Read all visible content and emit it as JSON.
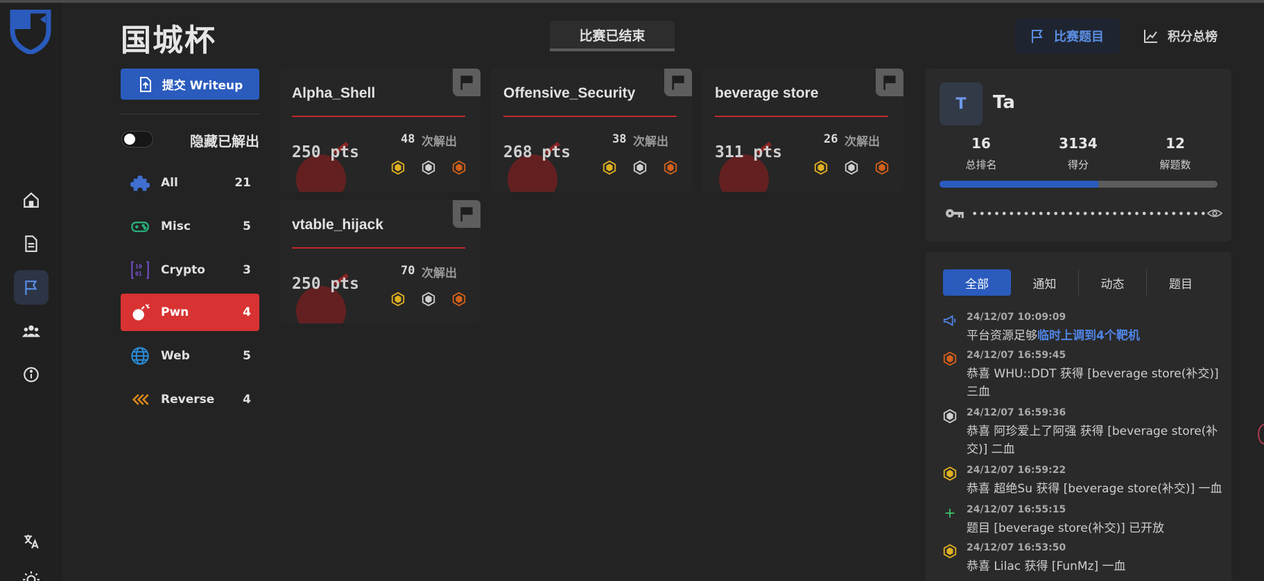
{
  "brand": "国城杯",
  "status": "比赛已结束",
  "nav": {
    "challenges": "比赛题目",
    "scoreboard": "积分总榜"
  },
  "submit_writeup": "提交 Writeup",
  "hide_solved": "隐藏已解出",
  "categories": [
    {
      "label": "All",
      "count": "21",
      "icon": "puzzle-icon"
    },
    {
      "label": "Misc",
      "count": "5",
      "icon": "gamepad-icon"
    },
    {
      "label": "Crypto",
      "count": "3",
      "icon": "binary-icon"
    },
    {
      "label": "Pwn",
      "count": "4",
      "icon": "bomb-icon"
    },
    {
      "label": "Web",
      "count": "5",
      "icon": "globe-icon"
    },
    {
      "label": "Reverse",
      "count": "4",
      "icon": "rewind-icon"
    }
  ],
  "challenges": [
    {
      "title": "Alpha_Shell",
      "points": "250 pts",
      "solves": "48",
      "solves_label": "次解出"
    },
    {
      "title": "Offensive_Security",
      "points": "268 pts",
      "solves": "38",
      "solves_label": "次解出"
    },
    {
      "title": "beverage store",
      "points": "311 pts",
      "solves": "26",
      "solves_label": "次解出"
    },
    {
      "title": "vtable_hijack",
      "points": "250 pts",
      "solves": "70",
      "solves_label": "次解出"
    }
  ],
  "user": {
    "avatar_letter": "T",
    "name": "Ta",
    "rank": "16",
    "rank_label": "总排名",
    "score": "3134",
    "score_label": "得分",
    "solved": "12",
    "solved_label": "解题数",
    "progress": 0.57,
    "token_masked": "••••••••••••••••••••••••••••••••"
  },
  "feed": {
    "tabs": [
      "全部",
      "通知",
      "动态",
      "题目"
    ],
    "entries": [
      {
        "icon": "megaphone-icon",
        "time": "24/12/07 10:09:09",
        "text": "平台资源足够",
        "highlight": "临时上调到4个靶机"
      },
      {
        "icon": "third-blood-icon",
        "time": "24/12/07 16:59:45",
        "text": "恭喜 WHU::DDT 获得 [beverage store(补交)] 三血"
      },
      {
        "icon": "second-blood-icon",
        "time": "24/12/07 16:59:36",
        "text": "恭喜 阿珍爱上了阿强 获得 [beverage store(补交)] 二血"
      },
      {
        "icon": "first-blood-icon",
        "time": "24/12/07 16:59:22",
        "text": "恭喜 超绝Su 获得 [beverage store(补交)] 一血"
      },
      {
        "icon": "plus-icon",
        "time": "24/12/07 16:55:15",
        "text": "题目 [beverage store(补交)] 已开放"
      },
      {
        "icon": "first-blood-icon",
        "time": "24/12/07 16:53:50",
        "text": "恭喜 Lilac 获得 [FunMz] 一血"
      }
    ]
  },
  "colors": {
    "accent": "#2a5bbd",
    "danger": "#d83232",
    "gold": "#e0b021",
    "silver": "#cfcfcf",
    "bronze": "#d2601a"
  }
}
